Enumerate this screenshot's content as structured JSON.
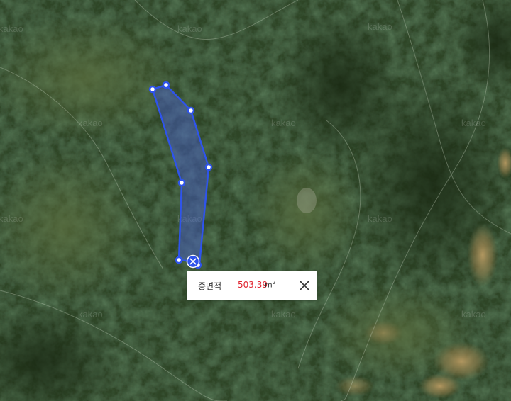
{
  "map": {
    "watermark_text": "kakao",
    "polygon": {
      "stroke_color": "#2f54eb",
      "fill_color": "#4a5fd8",
      "vertex_fill": "#ffffff"
    },
    "remove_icon": "close-icon"
  },
  "measure_popup": {
    "label": "종면적",
    "value": "503.39",
    "value_color": "#e0212c",
    "unit": "m",
    "unit_superscript": "2",
    "close_icon": "close-icon"
  }
}
